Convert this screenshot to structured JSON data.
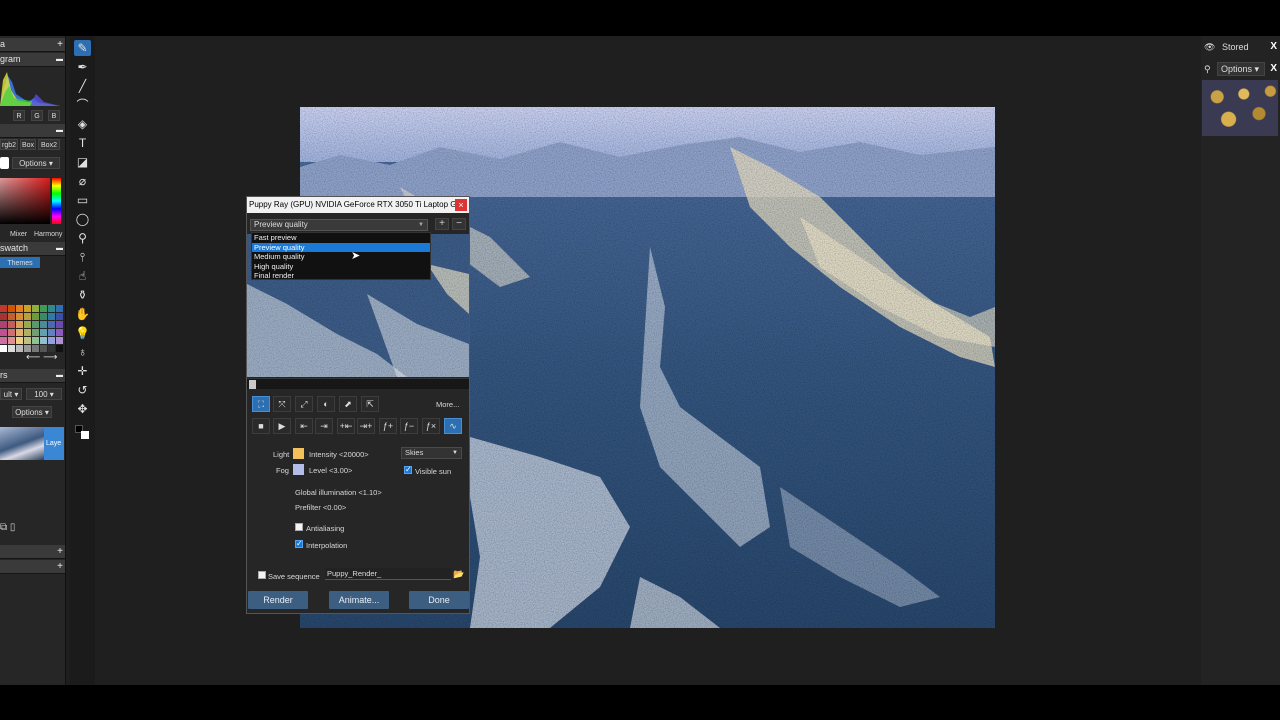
{
  "left_panel": {
    "header1_label": "a",
    "histogram_label": "gram",
    "channels": [
      "R",
      "G",
      "B"
    ],
    "modes": [
      "rgb2",
      "Box",
      "Box2"
    ],
    "options_label": "Options",
    "color_tabs": [
      "Mixer",
      "Harmony"
    ],
    "swatch_label": "swatch",
    "themes_label": "Themes",
    "layers_label": "rs",
    "blend_mode": "ult",
    "opacity": "100",
    "layer_options": "Options",
    "layer_name": "Laye"
  },
  "right_panel": {
    "stored_label": "Stored",
    "options_label": "Options"
  },
  "dialog": {
    "title": "Puppy Ray (GPU)  NVIDIA GeForce RTX 3050 Ti Laptop GP",
    "quality_selected": "Preview quality",
    "quality_options": [
      "Fast preview",
      "Preview quality",
      "Medium quality",
      "High quality",
      "Final render"
    ],
    "more_label": "More...",
    "light_label": "Light",
    "light_value": "Intensity <20000>",
    "light_color": "#f2c15a",
    "fog_label": "Fog",
    "fog_value": "Level <3.00>",
    "fog_color": "#b3bde8",
    "sky_select": "Skies",
    "visible_sun_label": "Visible sun",
    "gi_label": "Global illumination <1.10>",
    "prefilter_label": "Prefilter <0.00>",
    "antialiasing_label": "Antialiasing",
    "interpolation_label": "Interpolation",
    "save_sequence_label": "Save sequence",
    "sequence_name": "Puppy_Render_",
    "render_button": "Render",
    "animate_button": "Animate...",
    "done_button": "Done"
  },
  "colors": {
    "accent": "#2d6fb3",
    "button": "#3c5e80",
    "selection": "#1b7ad8"
  }
}
